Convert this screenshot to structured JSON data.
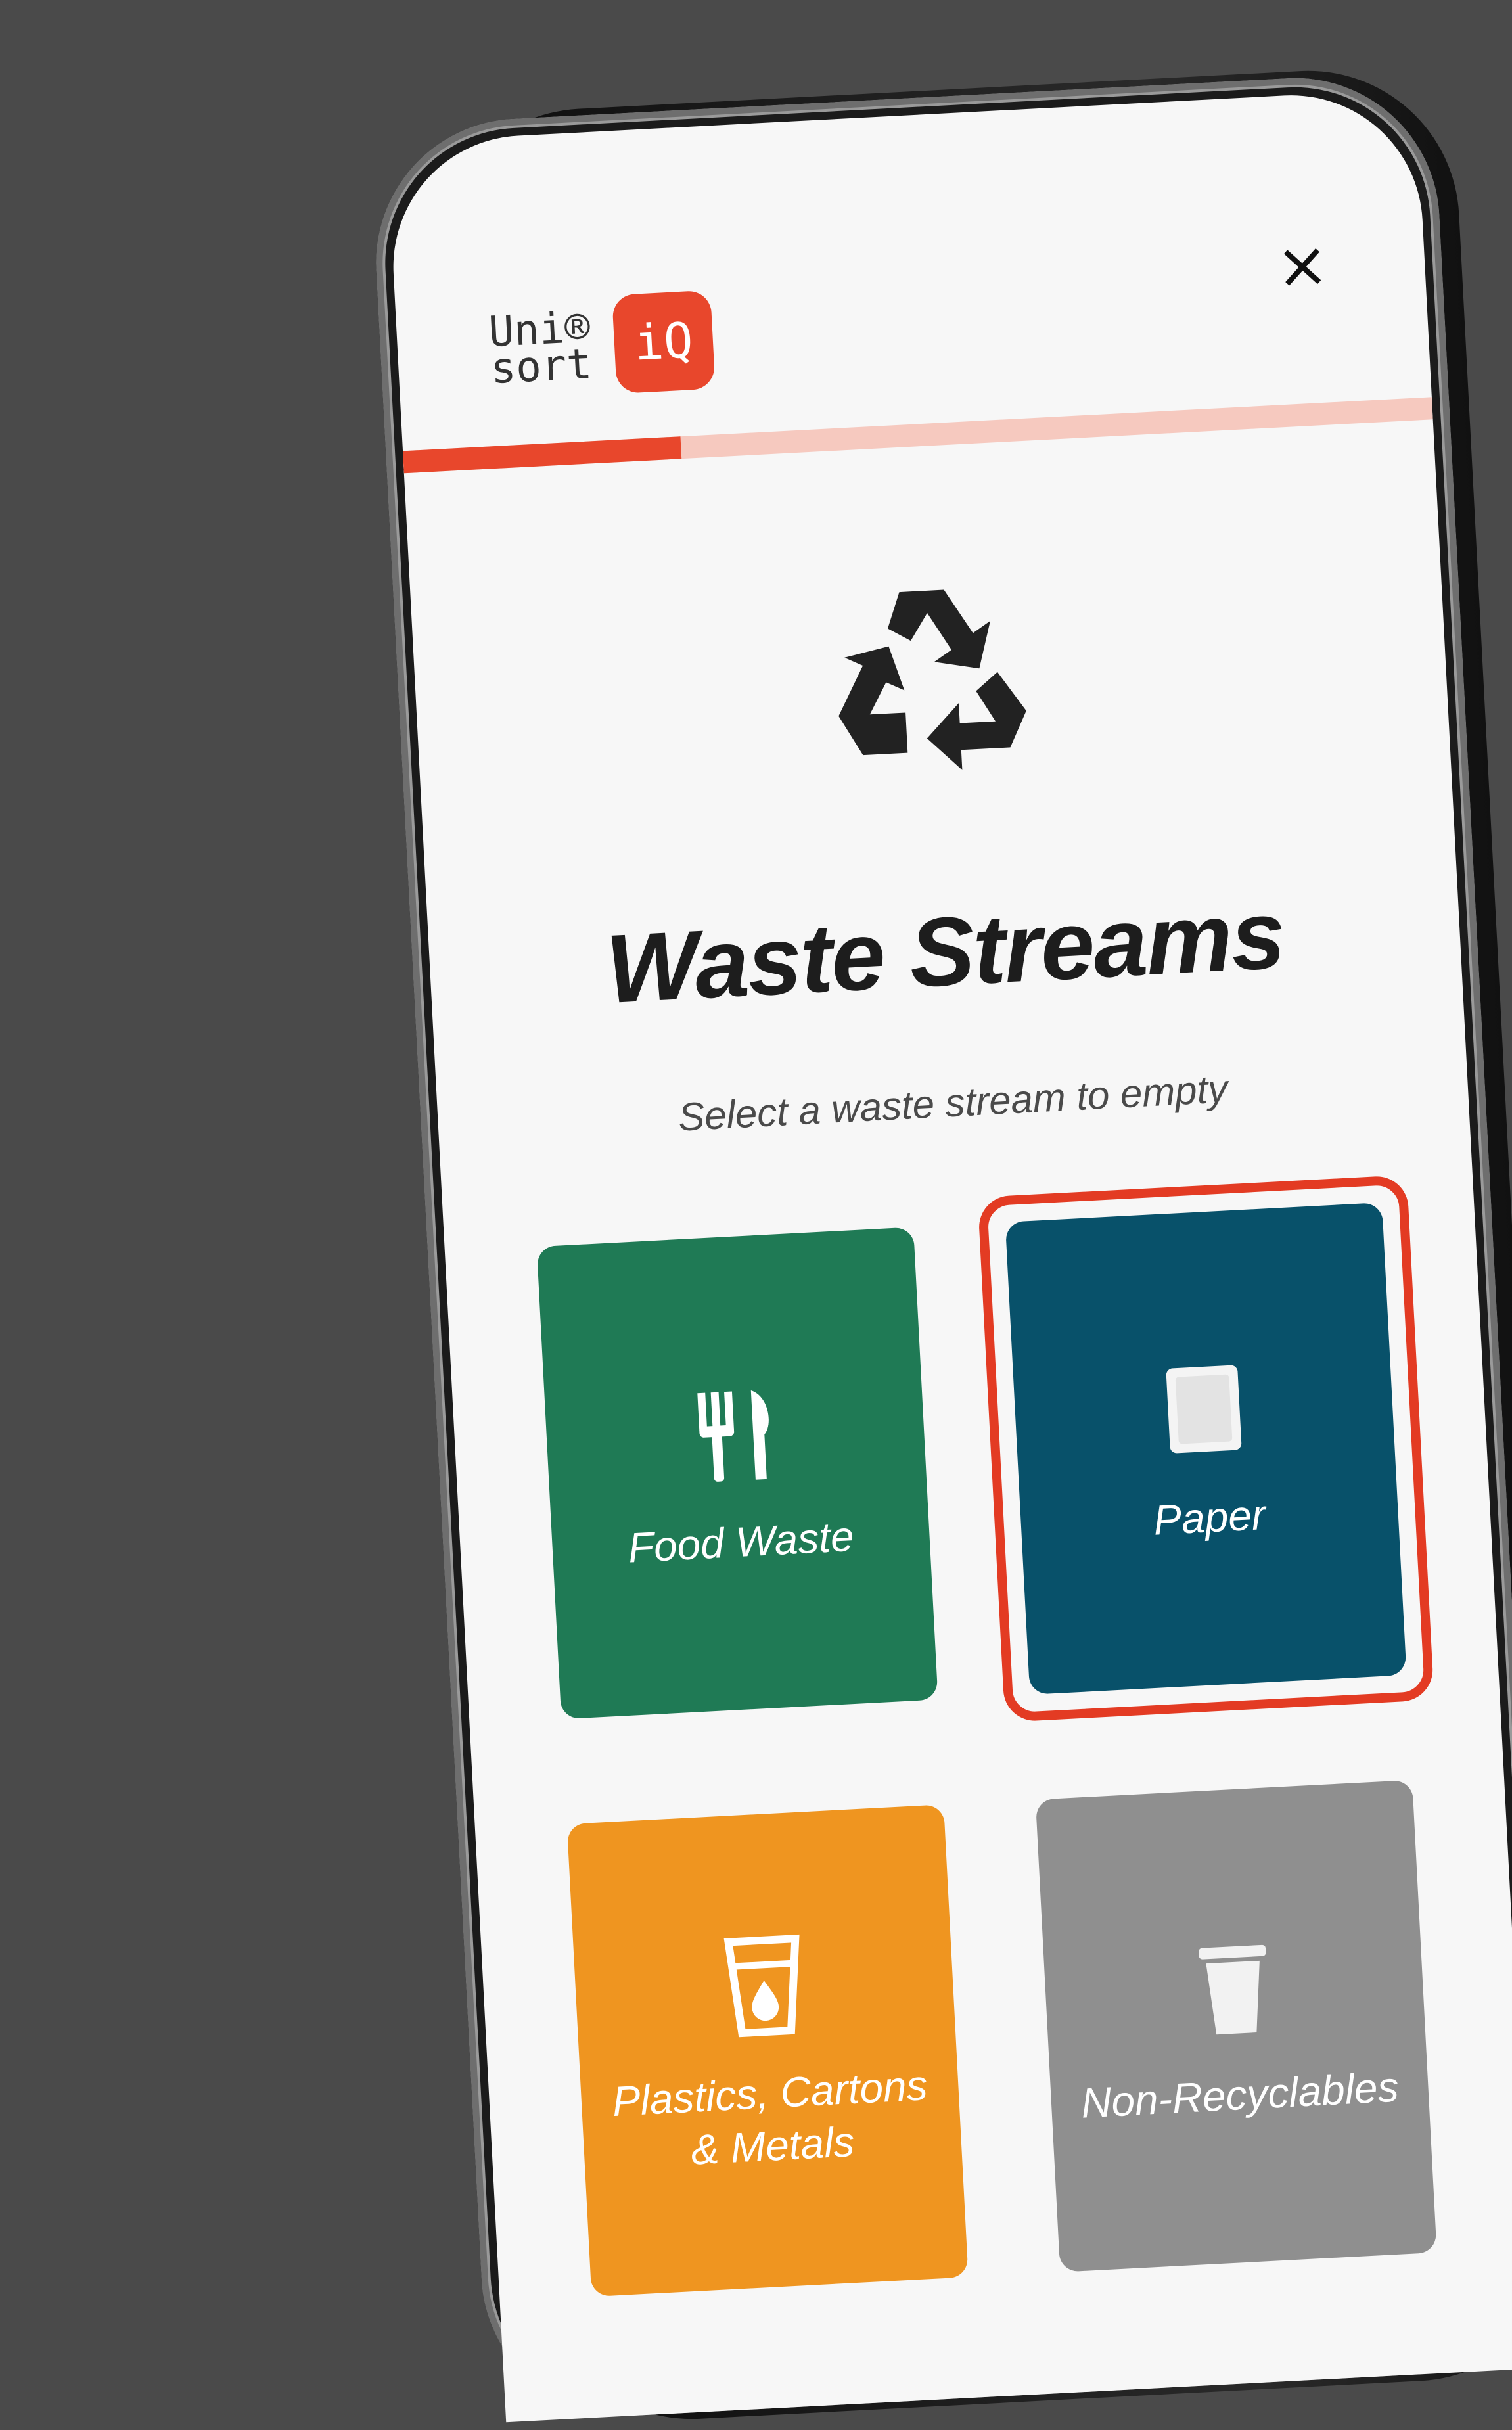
{
  "header": {
    "logo_text": "Uni®\nsort",
    "logo_badge": "iQ",
    "close_label": "×",
    "progress": 0.27
  },
  "main": {
    "icon": "recycle-icon",
    "title": "Waste Streams",
    "subtitle": "Select a waste stream to empty"
  },
  "streams": [
    {
      "label": "Food Waste",
      "icon": "utensils-icon",
      "color": "#1f7a55",
      "selected": false
    },
    {
      "label": "Paper",
      "icon": "paper-icon",
      "color": "#08516a",
      "selected": true
    },
    {
      "label": "Plastics, Cartons & Metals",
      "icon": "cup-icon",
      "color": "#ef9520",
      "selected": false
    },
    {
      "label": "Non-Recyclables",
      "icon": "bin-icon",
      "color": "#8f8f8f",
      "selected": false
    }
  ],
  "colors": {
    "accent": "#e8472c",
    "selection": "#e33b23"
  }
}
